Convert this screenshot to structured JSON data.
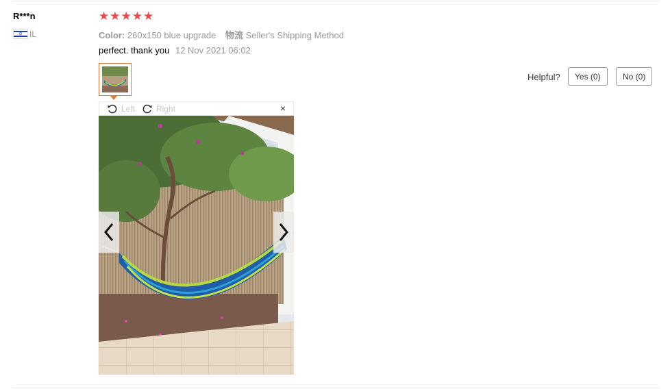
{
  "reviewer": {
    "name": "R***n",
    "country_code": "IL",
    "flag_icon": "israel-flag-icon"
  },
  "rating": {
    "value": 5,
    "max": 5,
    "color": "#f04848",
    "stars": [
      "★",
      "★",
      "★",
      "★",
      "★"
    ]
  },
  "meta": {
    "color_label": "Color:",
    "color_value": "260x150 blue upgrade",
    "shipping_label": "物流",
    "shipping_value": "Seller's Shipping Method"
  },
  "review": {
    "text": "perfect. thank you",
    "date": "12 Nov 2021 06:02"
  },
  "helpful": {
    "label": "Helpful?",
    "yes_label": "Yes (0)",
    "no_label": "No (0)"
  },
  "viewer": {
    "rotate_left_label": "Left",
    "rotate_right_label": "Right",
    "close_symbol": "×",
    "prev_symbol": "‹",
    "next_symbol": "›",
    "selected_thumb_border": "#e07b39"
  }
}
